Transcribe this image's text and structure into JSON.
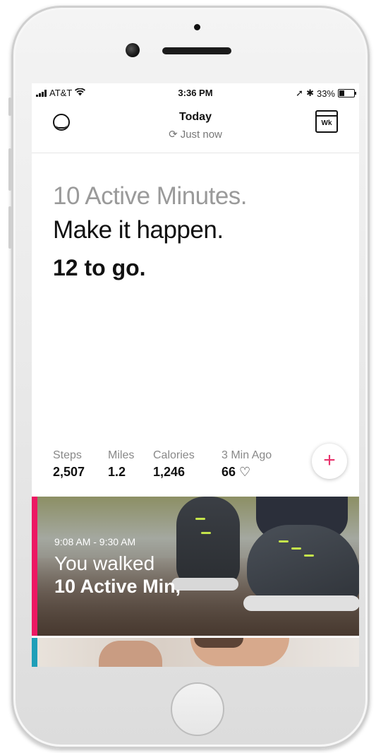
{
  "status_bar": {
    "carrier": "AT&T",
    "time": "3:36 PM",
    "battery_percent": "33%",
    "battery_level": 0.33
  },
  "header": {
    "title": "Today",
    "sync_status": "Just now",
    "week_button_label": "Wk"
  },
  "goal": {
    "line1": "10 Active Minutes.",
    "line2": "Make it happen.",
    "line3": "12 to go."
  },
  "stats": [
    {
      "label": "Steps",
      "value": "2,507"
    },
    {
      "label": "Miles",
      "value": "1.2"
    },
    {
      "label": "Calories",
      "value": "1,246"
    },
    {
      "label": "3 Min Ago",
      "value": "66"
    }
  ],
  "add_button": {
    "label": "+"
  },
  "activity_card": {
    "time_range": "9:08 AM - 9:30 AM",
    "line1": "You walked",
    "line2": "10 Active Min,",
    "accent_color": "#ec1863"
  },
  "sleep_card": {
    "accent_color": "#1f9fb8"
  },
  "icons": {
    "heart": "♡",
    "sync": "⟳",
    "wifi": "wifi-icon",
    "location": "➚",
    "bluetooth": "✱"
  }
}
